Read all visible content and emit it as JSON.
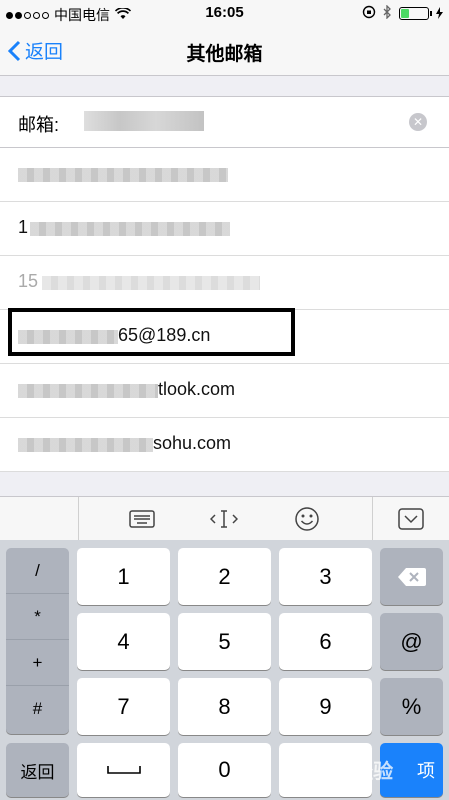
{
  "status_bar": {
    "carrier": "中国电信",
    "time": "16:05"
  },
  "nav": {
    "back_label": "返回",
    "title": "其他邮箱"
  },
  "email_field": {
    "label": "邮箱:"
  },
  "suggestions": [
    {
      "suffix": ""
    },
    {
      "prefix": "1",
      "suffix": ""
    },
    {
      "prefix": "15",
      "suffix": ""
    },
    {
      "suffix": "65@189.cn"
    },
    {
      "suffix": "tlook.com"
    },
    {
      "suffix": "sohu.com"
    }
  ],
  "keyboard": {
    "symbols": [
      "/",
      "*",
      "+",
      "#"
    ],
    "digits": [
      "1",
      "2",
      "3",
      "4",
      "5",
      "6",
      "7",
      "8",
      "9",
      "0"
    ],
    "at_key": "@",
    "percent_key": "%",
    "return_key": "返回",
    "done_key": "项",
    "watermark": "Bai经验"
  },
  "colors": {
    "accent": "#1a82fb",
    "battery": "#4cd964"
  }
}
